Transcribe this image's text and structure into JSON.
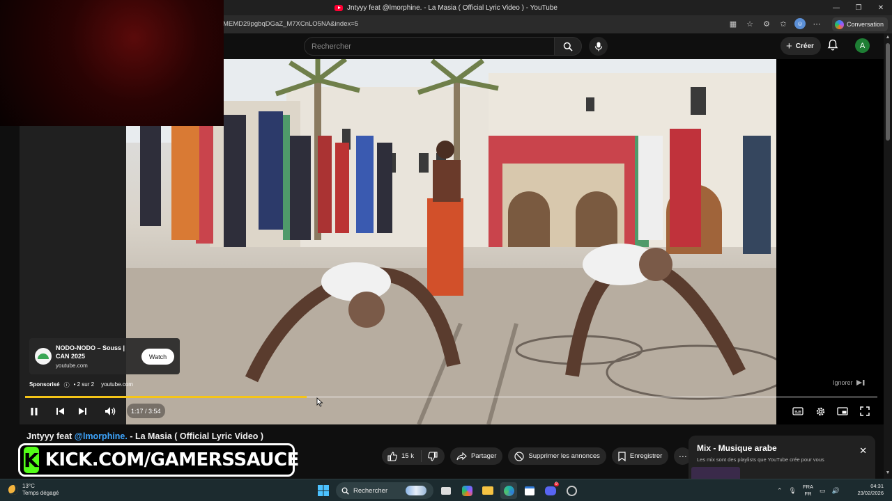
{
  "window": {
    "title": "Jntyyy feat @lmorphine. - La Masia ( Official Lyric Video ) - YouTube",
    "url": "MEMD29pgbqDGaZ_M7XCnLO5NA&index=5",
    "conversation_label": "Conversation"
  },
  "masthead": {
    "search_placeholder": "Rechercher",
    "create_label": "Créer",
    "account_initial": "A"
  },
  "ad": {
    "title": "NODO-NODO – Souss | CAN 2025",
    "domain": "youtube.com",
    "watch_label": "Watch",
    "sponsored_label": "Sponsorisé",
    "position": "• 2 sur 2",
    "meta_domain": "youtube.com",
    "skip_label": "Ignorer"
  },
  "player": {
    "time": "1:17 / 3:54",
    "progress": 0.33,
    "progress_color": "#f5c518"
  },
  "video": {
    "title_prefix": "Jntyyy feat ",
    "title_mention": "@lmorphine.",
    "title_suffix": " - La Masia ( Official Lyric Video )",
    "likes": "15 k",
    "share_label": "Partager",
    "remove_ads_label": "Supprimer les annonces",
    "save_label": "Enregistrer"
  },
  "overlay": {
    "kick_text": "KICK.COM/GAMERSSAUCE",
    "kick_logo": "K",
    "kick_color": "#53fc18"
  },
  "mix": {
    "title": "Mix - Musique arabe",
    "subtitle": "Les mix sont des playlists que YouTube crée pour vous"
  },
  "taskbar": {
    "temp": "13°C",
    "weather": "Temps dégagé",
    "search_label": "Rechercher",
    "lang_top": "FRA",
    "lang_bottom": "FR",
    "time": "04:31",
    "date": "23/02/2026",
    "discord_badge": "9"
  }
}
